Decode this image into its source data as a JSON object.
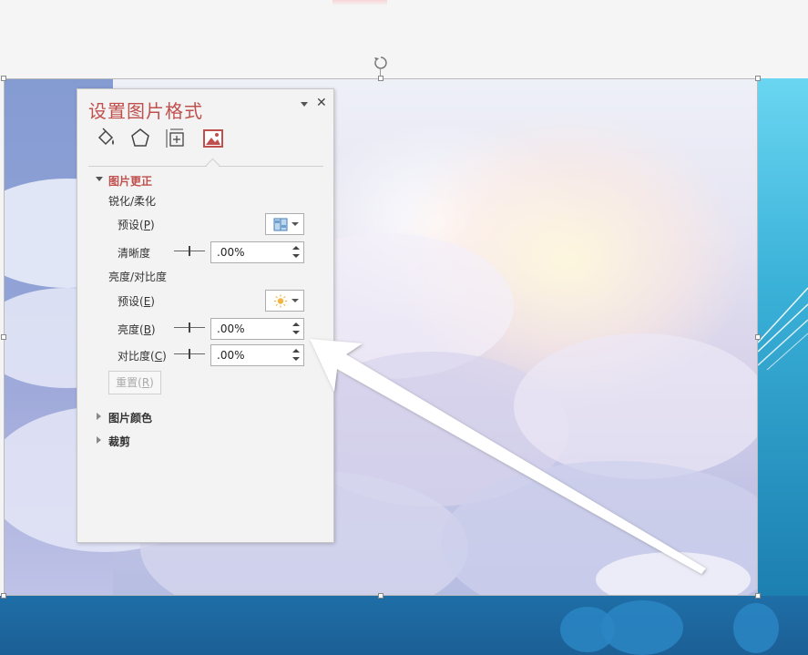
{
  "panel": {
    "title": "设置图片格式",
    "tabs": [
      {
        "icon": "fill-bucket-icon"
      },
      {
        "icon": "pentagon-effects-icon"
      },
      {
        "icon": "size-properties-icon"
      },
      {
        "icon": "picture-icon",
        "selected": true
      }
    ],
    "sections": {
      "correction": {
        "title": "图片更正",
        "expanded": true,
        "sharpen_heading": "锐化/柔化",
        "sharpen_preset_label": "预设(",
        "sharpen_preset_key": "P",
        "sharpness_label": "清晰度",
        "sharpness_value": ".00%",
        "brightness_contrast_heading": "亮度/对比度",
        "bc_preset_label": "预设(",
        "bc_preset_key": "E",
        "brightness_label": "亮度(",
        "brightness_key": "B",
        "brightness_value": ".00%",
        "contrast_label": "对比度(",
        "contrast_key": "C",
        "contrast_value": ".00%",
        "reset_label": "重置(",
        "reset_key": "R",
        "close_paren": ")"
      },
      "color": {
        "title": "图片颜色",
        "expanded": false
      },
      "crop": {
        "title": "裁剪",
        "expanded": false
      }
    }
  },
  "colors": {
    "accent": "#c0504d",
    "panel_bg": "#f3f3f3",
    "slide_blue": "#1f6ea7"
  }
}
